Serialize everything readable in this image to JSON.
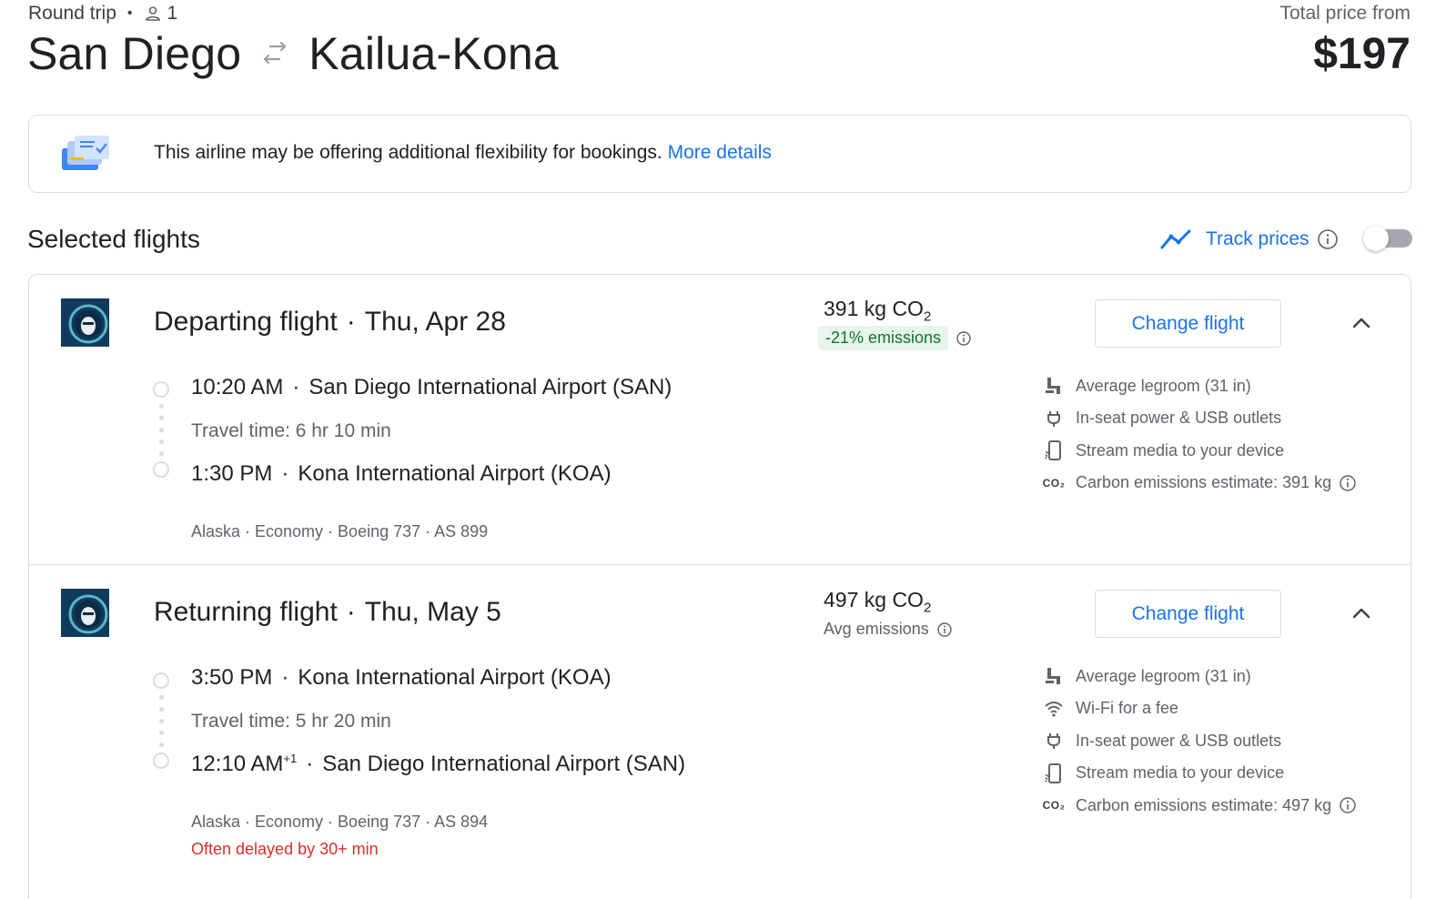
{
  "header": {
    "trip_type": "Round trip",
    "passengers": "1",
    "origin": "San Diego",
    "destination": "Kailua-Kona",
    "price_label": "Total price from",
    "price": "$197"
  },
  "banner": {
    "message": "This airline may be offering additional flexibility for bookings.",
    "link": "More details"
  },
  "section": {
    "title": "Selected flights",
    "track_label": "Track prices",
    "track_enabled": false
  },
  "flights": [
    {
      "title": "Departing flight",
      "date": "Thu, Apr 28",
      "co2": "391 kg CO",
      "co2_sub": "2",
      "emissions_badge": "-21% emissions",
      "change_label": "Change flight",
      "dep_time": "10:20 AM",
      "dep_airport": "San Diego International Airport (SAN)",
      "travel_time": "Travel time: 6 hr 10 min",
      "arr_time": "1:30 PM",
      "arr_day_offset": "",
      "arr_airport": "Kona International Airport (KOA)",
      "details": "Alaska · Economy · Boeing 737 · AS 899",
      "amenities": [
        {
          "icon": "legroom-icon",
          "text": "Average legroom (31 in)"
        },
        {
          "icon": "power-plug-icon",
          "text": "In-seat power & USB outlets"
        },
        {
          "icon": "stream-media-icon",
          "text": "Stream media to your device"
        },
        {
          "icon": "co2-icon",
          "text": "Carbon emissions estimate: 391 kg"
        }
      ]
    },
    {
      "title": "Returning flight",
      "date": "Thu, May 5",
      "co2": "497 kg CO",
      "co2_sub": "2",
      "emissions_text": "Avg emissions",
      "change_label": "Change flight",
      "dep_time": "3:50 PM",
      "dep_airport": "Kona International Airport (KOA)",
      "travel_time": "Travel time: 5 hr 20 min",
      "arr_time": "12:10 AM",
      "arr_day_offset": "+1",
      "arr_airport": "San Diego International Airport (SAN)",
      "details": "Alaska · Economy · Boeing 737 · AS 894",
      "delay": "Often delayed by 30+ min",
      "amenities": [
        {
          "icon": "legroom-icon",
          "text": "Average legroom (31 in)"
        },
        {
          "icon": "wifi-icon",
          "text": "Wi-Fi for a fee"
        },
        {
          "icon": "power-plug-icon",
          "text": "In-seat power & USB outlets"
        },
        {
          "icon": "stream-media-icon",
          "text": "Stream media to your device"
        },
        {
          "icon": "co2-icon",
          "text": "Carbon emissions estimate: 497 kg"
        }
      ]
    }
  ],
  "amenity_co2_glyph": "CO₂",
  "colors": {
    "accent": "#1a73e8",
    "text": "#202124",
    "muted": "#5f6368",
    "border": "#dadce0",
    "green_bg": "#e6f4ea",
    "green_text": "#137333",
    "delay_red": "#d93025",
    "airline_navy": "#0f3b5c"
  }
}
